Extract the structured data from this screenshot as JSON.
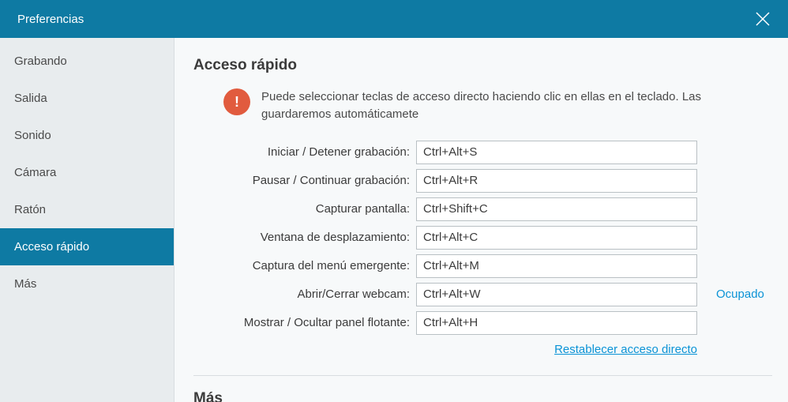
{
  "titlebar": {
    "title": "Preferencias"
  },
  "sidebar": {
    "items": [
      {
        "label": "Grabando"
      },
      {
        "label": "Salida"
      },
      {
        "label": "Sonido"
      },
      {
        "label": "Cámara"
      },
      {
        "label": "Ratón"
      },
      {
        "label": "Acceso rápido"
      },
      {
        "label": "Más"
      }
    ]
  },
  "section": {
    "quick_access_title": "Acceso rápido",
    "info_icon_char": "!",
    "info_text": "Puede seleccionar teclas de acceso directo haciendo clic en ellas en el teclado. Las guardaremos automáticamete",
    "shortcuts": [
      {
        "label": "Iniciar / Detener grabación:",
        "value": "Ctrl+Alt+S",
        "status": ""
      },
      {
        "label": "Pausar / Continuar grabación:",
        "value": "Ctrl+Alt+R",
        "status": ""
      },
      {
        "label": "Capturar pantalla:",
        "value": "Ctrl+Shift+C",
        "status": ""
      },
      {
        "label": "Ventana de desplazamiento:",
        "value": "Ctrl+Alt+C",
        "status": ""
      },
      {
        "label": "Captura del menú emergente:",
        "value": "Ctrl+Alt+M",
        "status": ""
      },
      {
        "label": "Abrir/Cerrar webcam:",
        "value": "Ctrl+Alt+W",
        "status": "Ocupado"
      },
      {
        "label": "Mostrar / Ocultar panel flotante:",
        "value": "Ctrl+Alt+H",
        "status": ""
      }
    ],
    "reset_link": "Restablecer acceso directo",
    "more_title": "Más"
  }
}
